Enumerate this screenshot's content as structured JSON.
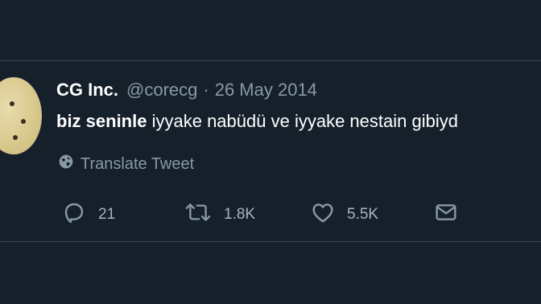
{
  "tweet": {
    "display_name": "CG Inc.",
    "handle": "@corecg",
    "separator": "·",
    "date": "26 May 2014",
    "text_bold": "biz seninle",
    "text_rest": " iyyake nabüdü ve iyyake nestain gibiyd",
    "translate_label": "Translate Tweet"
  },
  "actions": {
    "reply_count": "21",
    "retweet_count": "1.8K",
    "like_count": "5.5K"
  },
  "colors": {
    "background": "#15202b",
    "secondary_text": "#8899a6",
    "divider": "#38444d"
  },
  "icons": [
    "globe-icon",
    "reply-icon",
    "retweet-icon",
    "like-icon",
    "share-icon"
  ]
}
